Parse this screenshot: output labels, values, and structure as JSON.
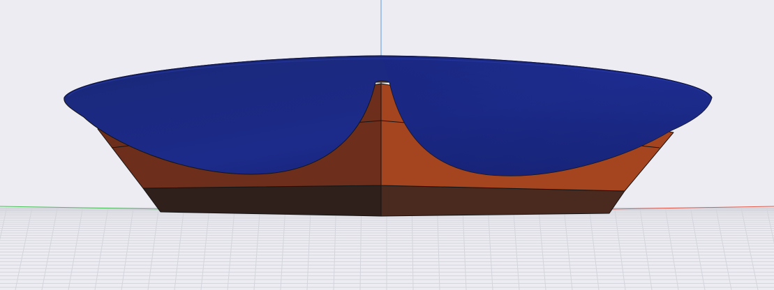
{
  "viewport": {
    "background": "#ececf2",
    "grid_color": "#d3d3db",
    "axis_colors": {
      "x": "#e05a4a",
      "y": "#4bbf5a",
      "z": "#5a9ae0"
    }
  },
  "model": {
    "type": "dish-on-tapered-base",
    "colors": {
      "dish_top": "#1e2f96",
      "dish_bottom": "#16206a",
      "dish_rim": "#1a2377",
      "base_left_upper": "#6e2e1c",
      "base_right_upper": "#a44520",
      "base_left_lower": "#2f201b",
      "base_right_lower": "#4a2a1f",
      "edge_lines": "#111111"
    }
  }
}
